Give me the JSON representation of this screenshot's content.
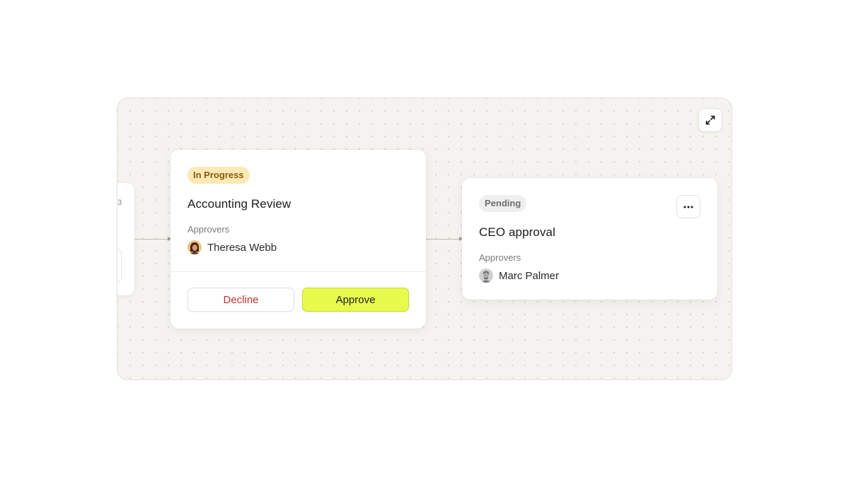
{
  "canvas": {
    "expand_icon": "expand-icon"
  },
  "partial_card": {
    "number": "3"
  },
  "steps": [
    {
      "status": "In Progress",
      "title": "Accounting Review",
      "approvers_label": "Approvers",
      "approver": "Theresa Webb",
      "decline_label": "Decline",
      "approve_label": "Approve"
    },
    {
      "status": "Pending",
      "title": "CEO approval",
      "approvers_label": "Approvers",
      "approver": "Marc Palmer",
      "more_icon": "more-horizontal-icon"
    }
  ],
  "colors": {
    "approve_accent": "#e8fb4c",
    "decline_text": "#c62f2f",
    "in_progress_bg": "#fde9b5",
    "in_progress_text": "#8a5a10",
    "pending_bg": "#efefef"
  }
}
